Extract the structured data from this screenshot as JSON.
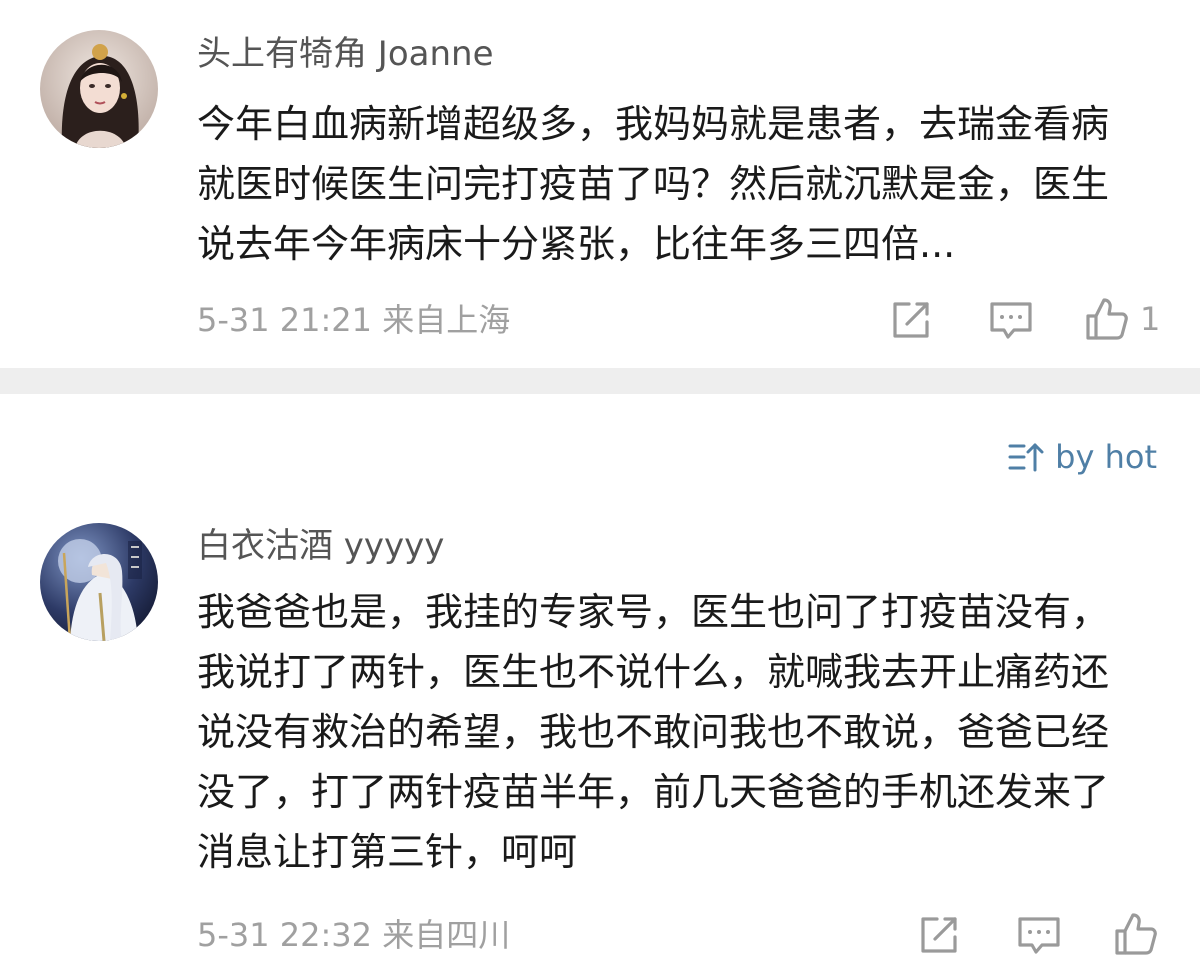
{
  "comments": [
    {
      "username": "头上有犄角 Joanne",
      "lines": [
        "今年白血病新增超级多，我妈妈就是患者，去瑞金看病",
        "就医时候医生问完打疫苗了吗？然后就沉默是金，医生",
        "说去年今年病床十分紧张，比往年多三四倍..."
      ],
      "time": "5-31 21:21",
      "location": "来自上海",
      "like_count": "1",
      "icons": {
        "share": "share-icon",
        "reply": "comment-icon",
        "like": "thumbs-up-icon"
      }
    },
    {
      "username": "白衣沽酒 yyyyy",
      "lines": [
        "我爸爸也是，我挂的专家号，医生也问了打疫苗没有，",
        "我说打了两针，医生也不说什么，就喊我去开止痛药还",
        "说没有救治的希望，我也不敢问我也不敢说，爸爸已经",
        "没了，打了两针疫苗半年，前几天爸爸的手机还发来了",
        "消息让打第三针，呵呵"
      ],
      "time": "5-31 22:32",
      "location": "来自四川",
      "icons": {
        "share": "share-icon",
        "reply": "comment-icon",
        "like": "thumbs-up-icon"
      }
    }
  ],
  "sort": {
    "label": "by hot",
    "icon": "sort-icon"
  },
  "colors": {
    "username": "#555555",
    "body_text": "#1a1a1a",
    "meta": "#a0a0a0",
    "icon": "#9a9a9a",
    "accent": "#4f7fa6",
    "divider": "#eeeeee"
  }
}
